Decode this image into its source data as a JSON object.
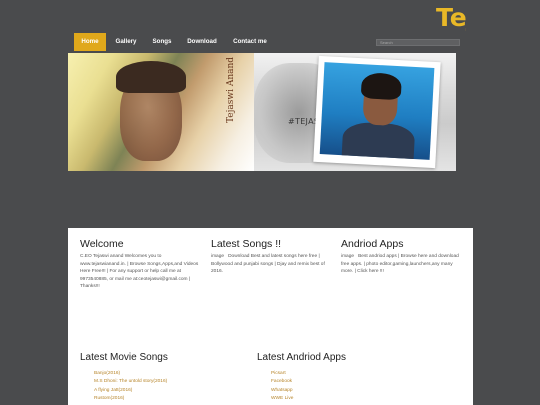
{
  "site": {
    "title": "Tejaswi"
  },
  "nav": {
    "items": [
      {
        "label": "Home",
        "active": true
      },
      {
        "label": "Gallery",
        "active": false
      },
      {
        "label": "Songs",
        "active": false
      },
      {
        "label": "Download",
        "active": false
      },
      {
        "label": "Contact me",
        "active": false
      }
    ],
    "search_placeholder": "Search"
  },
  "banner": {
    "left_text": "Tejaswi Anand",
    "right_tag": "#TEJASWI ANAND"
  },
  "welcome": {
    "title": "Welcome",
    "body": "C.EO Tejaswi anand Welcomes you to www.tejaswianand.in. | Browse Songs,Apps,and Videos Here Free!!! | For any support or help call me at 9973540885, or mail me at:ceotejaswi@gmail.com | Thanks!!!"
  },
  "latest_songs": {
    "title": "Latest Songs !!",
    "img_alt": "image",
    "body": "Download Best and latest songs here free | Bollywood and punjabi songs | Djay and remix best of 2016."
  },
  "android_apps": {
    "title": "Andriod Apps",
    "img_alt": "image",
    "body": "Best andriod apps | Browse here and download free apps. | photo editor,gaming,launchers,any many more. | Click here !!!"
  },
  "movie_songs": {
    "title": "Latest Movie Songs",
    "items": [
      "Banjo(2016)",
      "M.S Dhoni: The untold story(2016)",
      "A flying Jatt(2016)",
      "Rustom(2016)"
    ]
  },
  "latest_apps": {
    "title": "Latest Andriod Apps",
    "items": [
      "Picsart",
      "Facebook",
      "Whatsapp",
      "WWE Live"
    ]
  },
  "colors": {
    "accent": "#e0a81b",
    "title": "#e9b827",
    "background": "#4a4b4d",
    "link": "#b7852a"
  }
}
